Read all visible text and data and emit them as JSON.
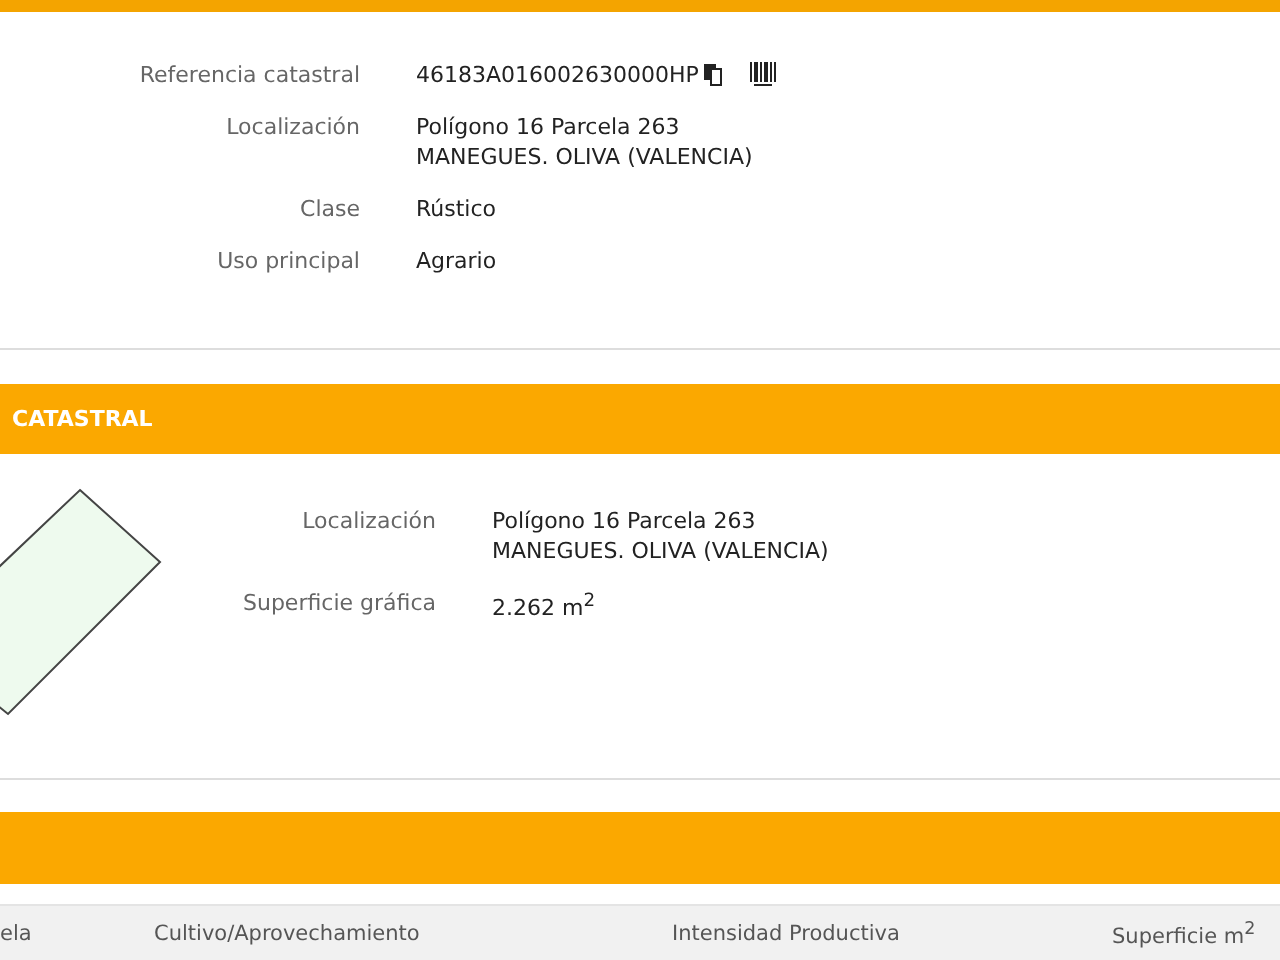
{
  "details": [
    {
      "label": "Referencia catastral",
      "lines": [
        "46183A016002630000HP"
      ],
      "kind": "reference"
    },
    {
      "label": "Localización",
      "lines": [
        "Polígono 16 Parcela 263",
        "MANEGUES. OLIVA (VALENCIA)"
      ],
      "kind": "text"
    },
    {
      "label": "Clase",
      "lines": [
        "Rústico"
      ],
      "kind": "text"
    },
    {
      "label": "Uso principal",
      "lines": [
        "Agrario"
      ],
      "kind": "text"
    }
  ],
  "parcel_section": {
    "title": "CATASTRAL",
    "fields": [
      {
        "label": "Localización",
        "lines": [
          "Polígono 16 Parcela 263",
          "MANEGUES. OLIVA (VALENCIA)"
        ]
      },
      {
        "label": "Superficie gráfica",
        "lines": [
          "2.262 m$^{2}$"
        ]
      }
    ]
  },
  "crops_table": {
    "columns": [
      "ela",
      "Cultivo/Aprovechamiento",
      "Intensidad Productiva",
      "Superficie m$^{2}$"
    ]
  }
}
